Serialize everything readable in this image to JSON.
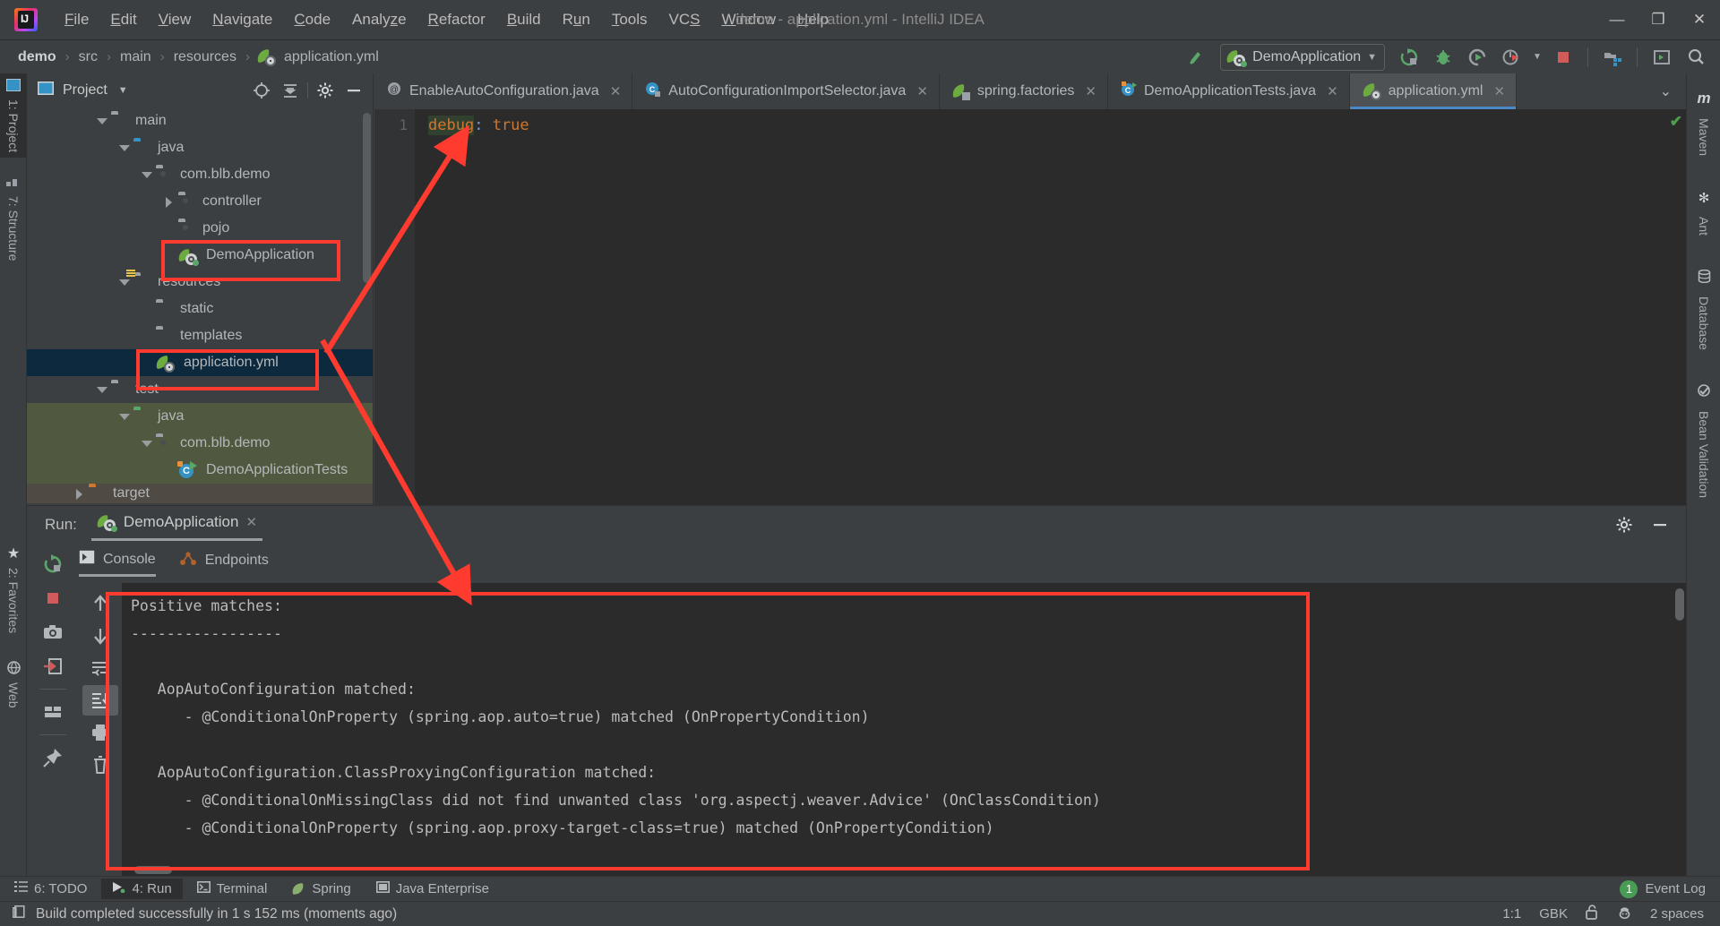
{
  "window": {
    "title": "demo - application.yml - IntelliJ IDEA",
    "minimize": "—",
    "maximize": "❐",
    "close": "✕"
  },
  "menu": [
    {
      "label": "File",
      "accel": "F"
    },
    {
      "label": "Edit",
      "accel": "E"
    },
    {
      "label": "View",
      "accel": "V"
    },
    {
      "label": "Navigate",
      "accel": "N"
    },
    {
      "label": "Code",
      "accel": "C"
    },
    {
      "label": "Analyze",
      "accel": "z"
    },
    {
      "label": "Refactor",
      "accel": "R"
    },
    {
      "label": "Build",
      "accel": "B"
    },
    {
      "label": "Run",
      "accel": "u"
    },
    {
      "label": "Tools",
      "accel": "T"
    },
    {
      "label": "VCS",
      "accel": "S"
    },
    {
      "label": "Window",
      "accel": "W"
    },
    {
      "label": "Help",
      "accel": "H"
    }
  ],
  "navbar": {
    "crumbs": [
      "demo",
      "src",
      "main",
      "resources",
      "application.yml"
    ],
    "separator": "›",
    "run_config": "DemoApplication",
    "run_config_caret": "▼",
    "icons": [
      "build-hammer-icon",
      "rerun-icon",
      "debug-bug-icon",
      "run-with-coverage-icon",
      "profiler-icon",
      "stop-icon",
      "project-structure-icon",
      "new-window-icon",
      "search-everywhere-icon"
    ]
  },
  "left_strip": [
    {
      "label": "1: Project",
      "accel": "1",
      "icon": "project-icon",
      "selected": true
    },
    {
      "label": "7: Structure",
      "accel": "7",
      "icon": "structure-icon",
      "selected": false
    },
    {
      "label": "2: Favorites",
      "accel": "2",
      "icon": "star-icon",
      "selected": false
    },
    {
      "label": "Web",
      "accel": "",
      "icon": "web-icon",
      "selected": false
    }
  ],
  "right_strip": [
    {
      "label": "Maven",
      "icon": "maven-m-icon"
    },
    {
      "label": "Ant",
      "icon": "ant-icon"
    },
    {
      "label": "Database",
      "icon": "database-icon"
    },
    {
      "label": "Bean Validation",
      "icon": "bean-validation-icon"
    }
  ],
  "project_panel": {
    "title": "Project",
    "caret": "▼",
    "header_icons": [
      "locate-icon",
      "collapse-all-icon",
      "settings-gear-icon",
      "hide-icon"
    ],
    "tree": [
      {
        "label": "main",
        "indent": 2,
        "arrow": "down",
        "icon": "folder-grey",
        "state": "normal"
      },
      {
        "label": "java",
        "indent": 3,
        "arrow": "down",
        "icon": "folder-blue",
        "state": "normal"
      },
      {
        "label": "com.blb.demo",
        "indent": 4,
        "arrow": "down",
        "icon": "package",
        "state": "normal"
      },
      {
        "label": "controller",
        "indent": 5,
        "arrow": "right",
        "icon": "package",
        "state": "normal"
      },
      {
        "label": "pojo",
        "indent": 5,
        "arrow": "none",
        "icon": "package",
        "state": "normal"
      },
      {
        "label": "DemoApplication",
        "indent": 5,
        "arrow": "none",
        "icon": "spring-run",
        "state": "normal"
      },
      {
        "label": "resources",
        "indent": 3,
        "arrow": "down",
        "icon": "folder-res",
        "state": "normal"
      },
      {
        "label": "static",
        "indent": 4,
        "arrow": "none",
        "icon": "folder-grey",
        "state": "normal"
      },
      {
        "label": "templates",
        "indent": 4,
        "arrow": "none",
        "icon": "folder-grey",
        "state": "normal"
      },
      {
        "label": "application.yml",
        "indent": 4,
        "arrow": "none",
        "icon": "spring-leaf",
        "state": "selected"
      },
      {
        "label": "test",
        "indent": 2,
        "arrow": "down",
        "icon": "folder-grey",
        "state": "normal"
      },
      {
        "label": "java",
        "indent": 3,
        "arrow": "down",
        "icon": "folder-green",
        "state": "testsrc"
      },
      {
        "label": "com.blb.demo",
        "indent": 4,
        "arrow": "down",
        "icon": "package",
        "state": "testsrc"
      },
      {
        "label": "DemoApplicationTests",
        "indent": 5,
        "arrow": "none",
        "icon": "test-class",
        "state": "testsrc"
      },
      {
        "label": "target",
        "indent": 1,
        "arrow": "right",
        "icon": "folder-orange",
        "state": "targetrow"
      }
    ]
  },
  "editor": {
    "tabs": [
      {
        "label": "EnableAutoConfiguration.java",
        "icon": "java-annotation-icon",
        "active": false,
        "close": "✕"
      },
      {
        "label": "AutoConfigurationImportSelector.java",
        "icon": "java-class-icon",
        "active": false,
        "close": "✕"
      },
      {
        "label": "spring.factories",
        "icon": "spring-factories-icon",
        "active": false,
        "close": "✕"
      },
      {
        "label": "DemoApplicationTests.java",
        "icon": "java-test-icon",
        "active": false,
        "close": "✕"
      },
      {
        "label": "application.yml",
        "icon": "spring-yaml-icon",
        "active": true,
        "close": "✕"
      }
    ],
    "tabs_overflow": "⌄",
    "line_number": "1",
    "code_key": "debug",
    "code_colon": ":",
    "code_value": "true",
    "inspection_status": "✔"
  },
  "run_panel": {
    "run_label": "Run:",
    "config_name": "DemoApplication",
    "config_close": "✕",
    "header_icons": [
      "settings-gear-icon",
      "hide-panel-icon"
    ],
    "sub_tabs": [
      {
        "label": "Console",
        "icon": "console-icon",
        "active": true
      },
      {
        "label": "Endpoints",
        "icon": "endpoints-icon",
        "active": false
      }
    ],
    "left_tools": [
      "rerun-icon",
      "stop-icon",
      "screenshot-camera-icon",
      "export-icon",
      "layout-icon",
      "pin-icon"
    ],
    "console_tools": [
      "scroll-up-icon",
      "scroll-down-icon",
      "soft-wrap-icon",
      "scroll-to-end-icon",
      "print-icon",
      "clear-all-icon"
    ],
    "console_text": "Positive matches:\n-----------------\n\n   AopAutoConfiguration matched:\n      - @ConditionalOnProperty (spring.aop.auto=true) matched (OnPropertyCondition)\n\n   AopAutoConfiguration.ClassProxyingConfiguration matched:\n      - @ConditionalOnMissingClass did not find unwanted class 'org.aspectj.weaver.Advice' (OnClassCondition)\n      - @ConditionalOnProperty (spring.aop.proxy-target-class=true) matched (OnPropertyCondition)"
  },
  "bottom_strip": {
    "tabs": [
      {
        "label": "6: TODO",
        "accel": "6",
        "icon": "todo-icon",
        "selected": false
      },
      {
        "label": "4: Run",
        "accel": "4",
        "icon": "run-green-icon",
        "selected": true
      },
      {
        "label": "Terminal",
        "accel": "",
        "icon": "terminal-icon",
        "selected": false
      },
      {
        "label": "Spring",
        "accel": "",
        "icon": "spring-leaf-icon",
        "selected": false
      },
      {
        "label": "Java Enterprise",
        "accel": "",
        "icon": "java-enterprise-icon",
        "selected": false
      }
    ],
    "event_log": "Event Log",
    "event_count": "1"
  },
  "status_bar": {
    "message": "Build completed successfully in 1 s 152 ms (moments ago)",
    "caret_position": "1:1",
    "encoding": "GBK",
    "lock": "unlocked-padlock-icon",
    "inspector": "inspector-hat-icon",
    "indent": "2 spaces"
  },
  "annotations": {
    "highlight_color": "#ff3b30",
    "boxes": [
      "demoapplication-tree-item",
      "application-yml-tree-item",
      "console-output-region"
    ],
    "arrows": [
      "arrow-from-demoapplication-to-editor",
      "arrow-from-application-yml-to-console"
    ]
  }
}
